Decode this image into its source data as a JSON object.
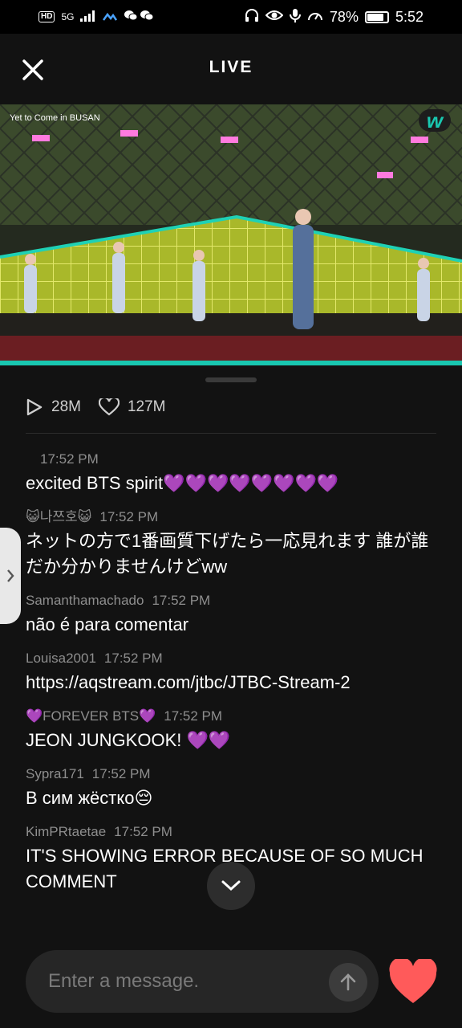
{
  "status_bar": {
    "hd": "HD",
    "network": "5G",
    "battery": "78%",
    "time": "5:52",
    "icons": [
      "signal-icon",
      "wechat-icon",
      "headphones-icon",
      "eye-icon",
      "mic-icon",
      "speedometer-icon",
      "battery-icon"
    ]
  },
  "header": {
    "title": "LIVE"
  },
  "video": {
    "event_logo_text": "Yet to Come in BUSAN",
    "brand": "w",
    "colors": {
      "progress": "#19c7b0",
      "stage_screen": "#b7c82a"
    }
  },
  "stats": {
    "plays": "28M",
    "likes": "127M"
  },
  "messages": [
    {
      "user": "",
      "time": "17:52 PM",
      "text": "excited BTS spirit💜💜💜💜💜💜💜💜"
    },
    {
      "user": "😺나쯔호😺",
      "time": "17:52 PM",
      "text": "ネットの方で1番画質下げたら一応見れます 誰が誰だか分かりませんけどww"
    },
    {
      "user": "Samanthamachado",
      "time": "17:52 PM",
      "text": "não é para comentar"
    },
    {
      "user": "Louisa2001",
      "time": "17:52 PM",
      "text": "https://aqstream.com/jtbc/JTBC-Stream-2"
    },
    {
      "user": "💜FOREVER BTS💜",
      "time": "17:52 PM",
      "text": "JEON JUNGKOOK! 💜💜"
    },
    {
      "user": "Sypra171",
      "time": "17:52 PM",
      "text": "В сим жёстко😔"
    },
    {
      "user": "KimPRtaetae",
      "time": "17:52 PM",
      "text": "IT'S SHOWING ERROR BECAUSE OF SO MUCH COMMENT"
    }
  ],
  "input": {
    "placeholder": "Enter a message."
  },
  "colors": {
    "heart": "#ff5a5a",
    "accent": "#19c7b0"
  }
}
